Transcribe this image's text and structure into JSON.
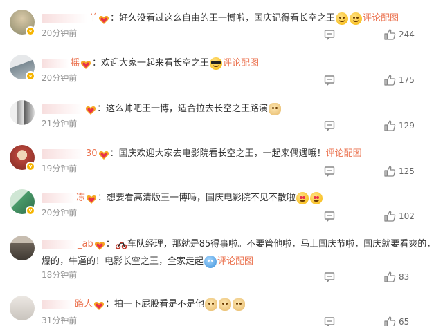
{
  "comments": [
    {
      "id": "c1",
      "name_suffix": "羊",
      "avatar_color": "#8d8a6b",
      "segments": [
        {
          "t": "text",
          "v": "好久没看过这么自由的王一博啦，国庆记得看长空之王"
        },
        {
          "t": "emoji",
          "v": "smile-emoji"
        },
        {
          "t": "emoji",
          "v": "smile-emoji"
        },
        {
          "t": "link",
          "v": "评论配图"
        }
      ],
      "time": "20分钟前",
      "likes": "244"
    },
    {
      "id": "c2",
      "name_suffix": "摇",
      "avatar_color": "#9aa4aa",
      "segments": [
        {
          "t": "text",
          "v": "欢迎大家一起来看长空之王"
        },
        {
          "t": "emoji",
          "v": "sunglasses-emoji"
        },
        {
          "t": "link",
          "v": "评论配图"
        }
      ],
      "time": "20分钟前",
      "likes": "175"
    },
    {
      "id": "c3",
      "name_suffix": "",
      "avatar_color": "#cfcfcf",
      "segments": [
        {
          "t": "text",
          "v": "这么帅吧王一博，适合拉去长空之王路演"
        },
        {
          "t": "emoji",
          "v": "doge-emoji"
        }
      ],
      "time": "21分钟前",
      "likes": "129"
    },
    {
      "id": "c4",
      "name_suffix": "30",
      "avatar_color": "#b6443a",
      "segments": [
        {
          "t": "text",
          "v": "国庆欢迎大家去电影院看长空之王，一起来偶遇哦！"
        },
        {
          "t": "link",
          "v": "评论配图"
        }
      ],
      "time": "19分钟前",
      "likes": "125"
    },
    {
      "id": "c5",
      "name_suffix": "冻",
      "avatar_color": "#4a9a6a",
      "segments": [
        {
          "t": "text",
          "v": "想要看高清版王一博吗，国庆电影院不见不散啦"
        },
        {
          "t": "emoji",
          "v": "heart-eyes-emoji"
        },
        {
          "t": "emoji",
          "v": "heart-eyes-emoji"
        }
      ],
      "time": "20分钟前",
      "likes": "102"
    },
    {
      "id": "c6",
      "name_suffix": "_ab",
      "avatar_color": "#6a6157",
      "segments": [
        {
          "t": "emoji",
          "v": "motorcycle-emoji"
        },
        {
          "t": "text",
          "v": "车队经理，那就是85得事啦。不要管他啦，马上国庆节啦，国庆就要看爽的，爆的，牛逼的！电影长空之王，全家走起"
        },
        {
          "t": "emoji",
          "v": "cheer-emoji"
        },
        {
          "t": "link",
          "v": "评论配图"
        }
      ],
      "time": "18分钟前",
      "likes": "83"
    },
    {
      "id": "c7",
      "name_suffix": "路人",
      "avatar_color": "#c9c4bd",
      "segments": [
        {
          "t": "text",
          "v": "拍一下屁股看是不是他"
        },
        {
          "t": "emoji",
          "v": "doge-emoji"
        },
        {
          "t": "emoji",
          "v": "doge-emoji"
        },
        {
          "t": "emoji",
          "v": "doge-emoji"
        }
      ],
      "time": "31分钟前",
      "likes": "65"
    }
  ],
  "colon": "：",
  "badge_icon": "verified-badge-icon",
  "fan_icon": "fan-heart-icon",
  "comment_icon": "comment-icon",
  "like_icon": "thumbs-up-icon",
  "accent_color": "#eb7350"
}
